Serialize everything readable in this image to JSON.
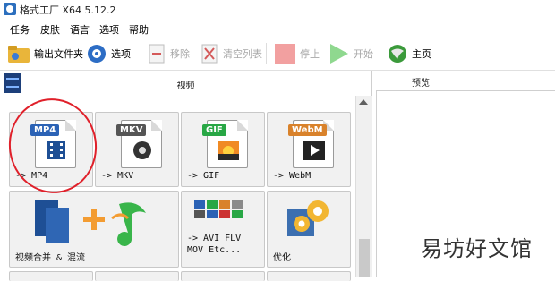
{
  "window": {
    "title": "格式工厂 X64 5.12.2"
  },
  "menu": {
    "items": [
      "任务",
      "皮肤",
      "语言",
      "选项",
      "帮助"
    ]
  },
  "toolbar": {
    "output_folder": "输出文件夹",
    "options": "选项",
    "remove": "移除",
    "clear_list": "清空列表",
    "stop": "停止",
    "start": "开始",
    "home": "主页"
  },
  "category": {
    "title": "视频"
  },
  "tiles": [
    {
      "badge": "MP4",
      "label": "-> MP4",
      "badge_color": "#2b62b5"
    },
    {
      "badge": "MKV",
      "label": "-> MKV",
      "badge_color": "#555555"
    },
    {
      "badge": "GIF",
      "label": "-> GIF",
      "badge_color": "#28a745"
    },
    {
      "badge": "WebM",
      "label": "-> WebM",
      "badge_color": "#d9822b"
    },
    {
      "label": "视频合并 & 混流"
    },
    {
      "label": "-> AVI FLV\nMOV Etc..."
    },
    {
      "label": "优化"
    }
  ],
  "preview": {
    "title": "预览"
  },
  "watermark": "易坊好文馆",
  "colors": {
    "highlight_circle": "#e0202a",
    "stop_button": "#f2a0a0",
    "start_button": "#8fd88f"
  }
}
